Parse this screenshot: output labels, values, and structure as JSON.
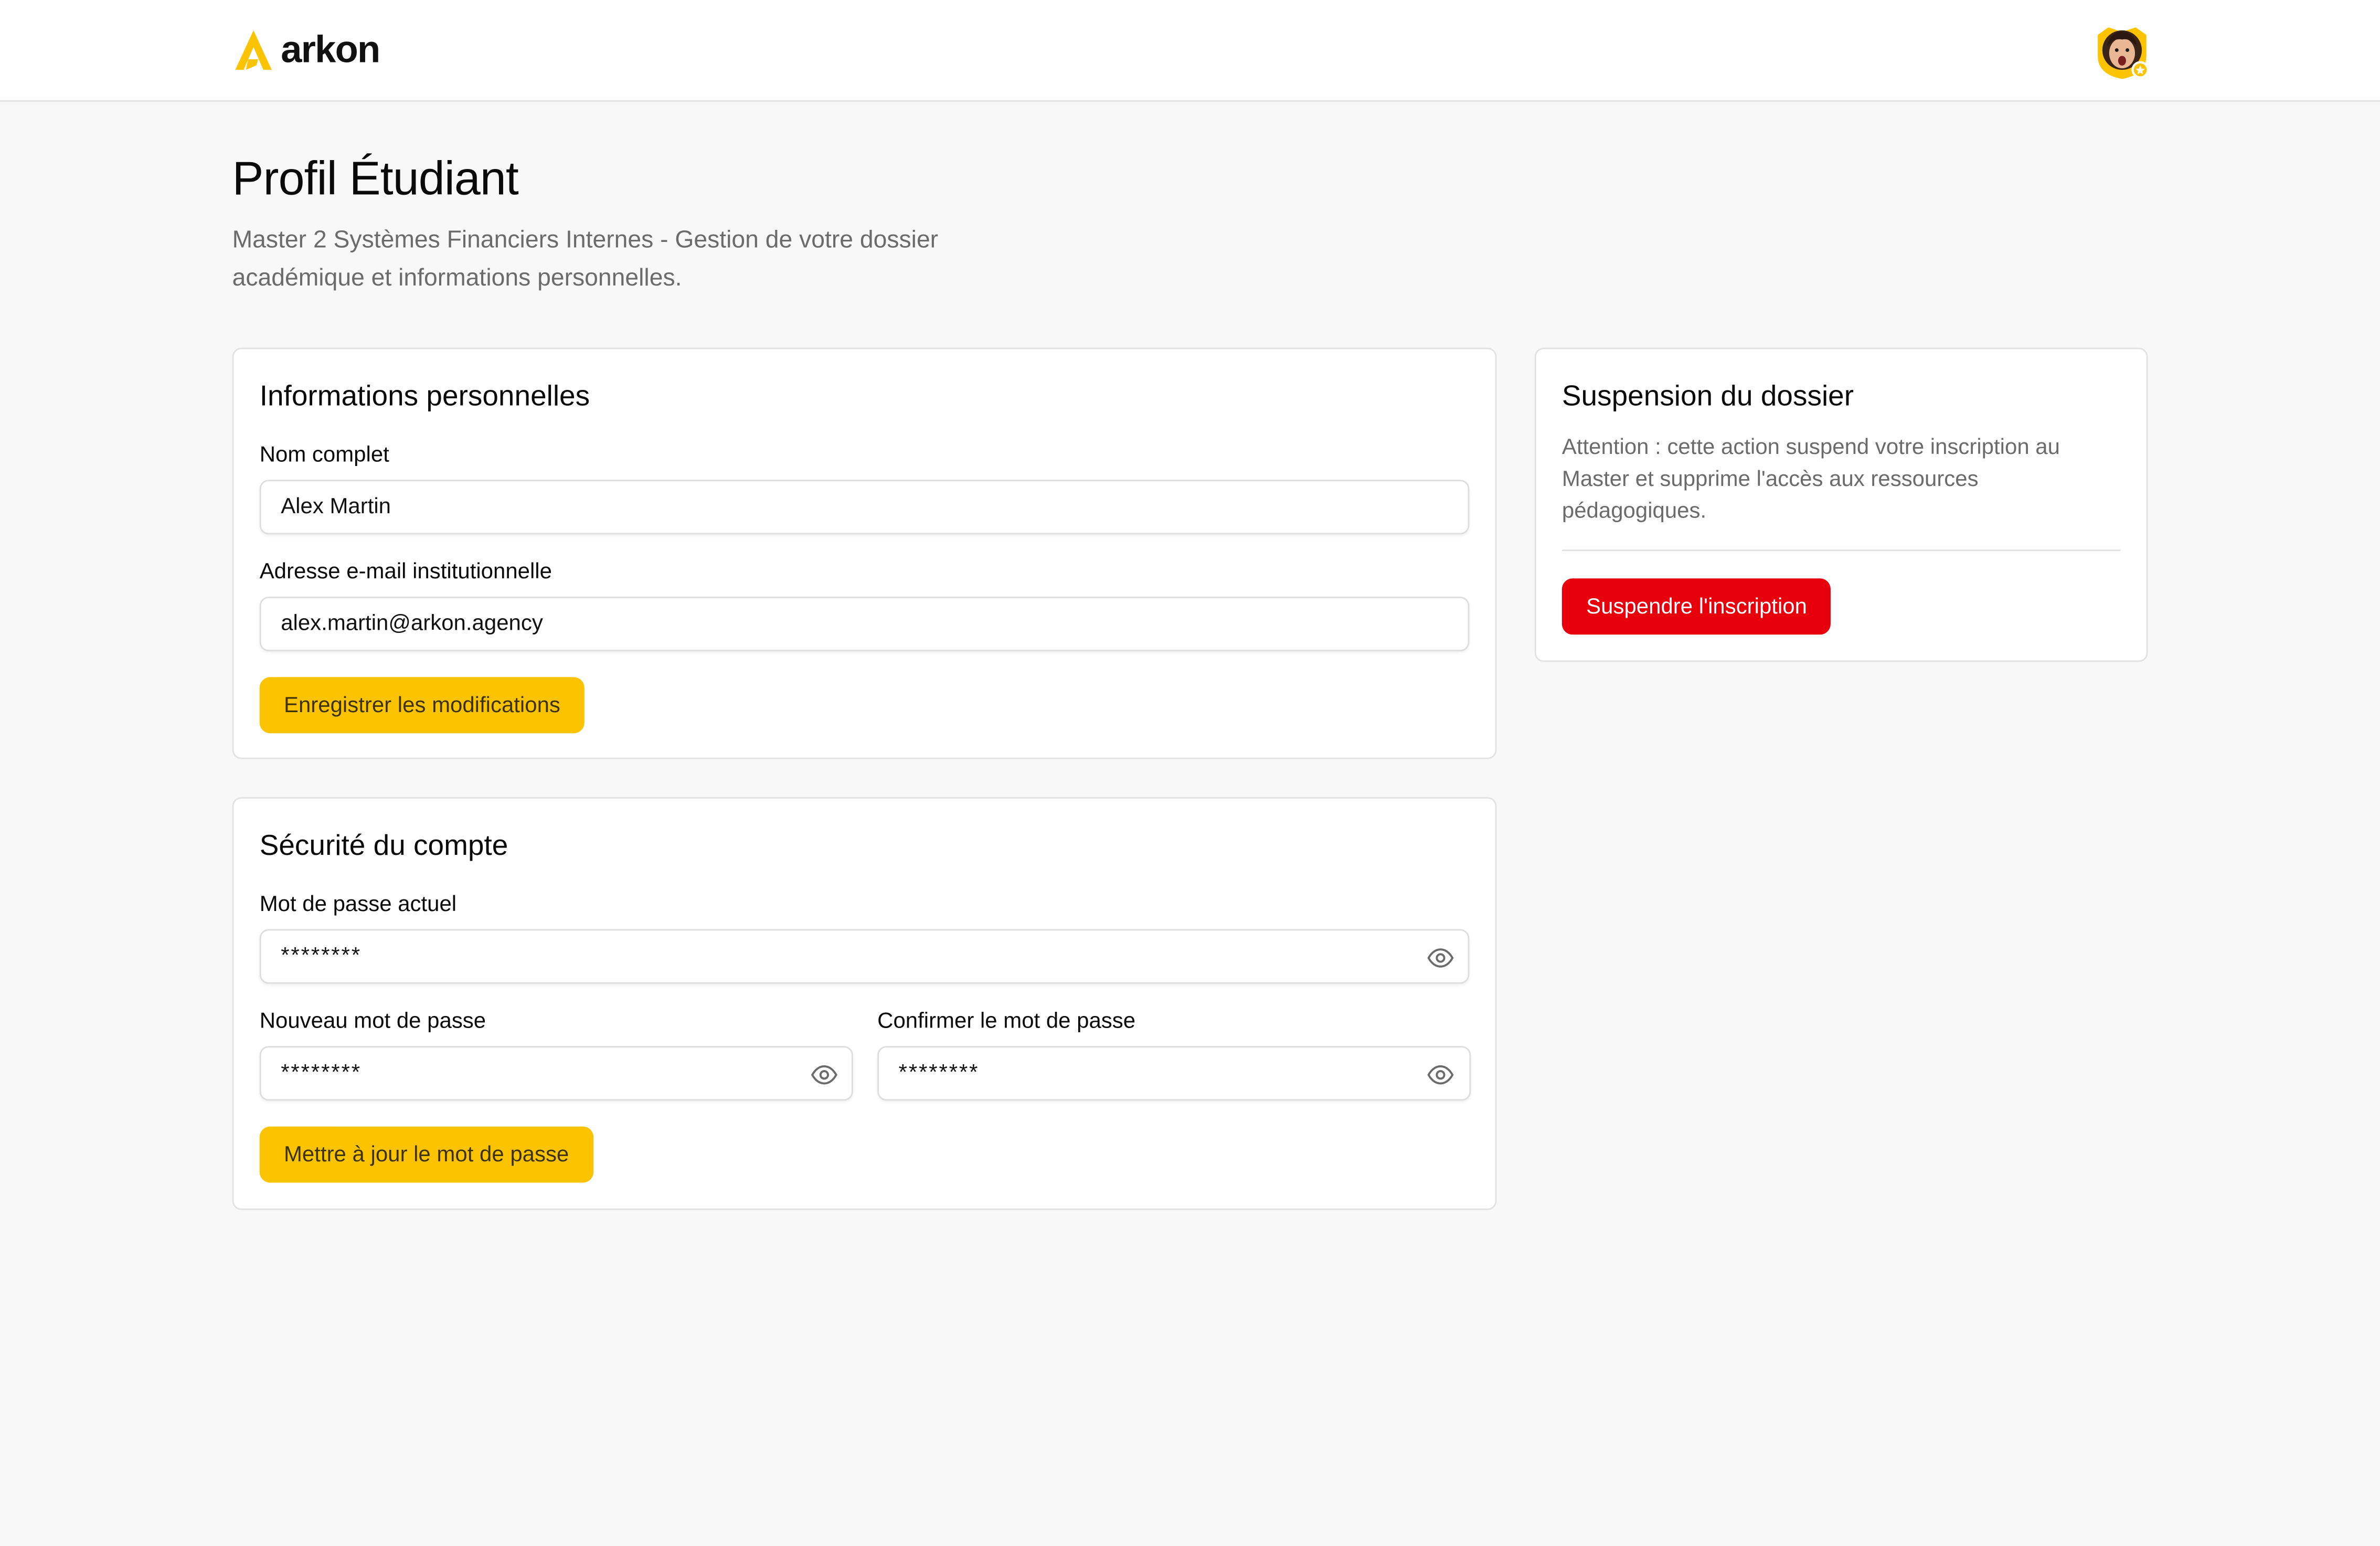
{
  "brand": {
    "name": "arkon",
    "accent_color": "#fcc400",
    "logo_icon": "arkon-logo-icon"
  },
  "header": {
    "avatar_icon": "user-avatar"
  },
  "page": {
    "title": "Profil Étudiant",
    "subtitle": "Master 2 Systèmes Financiers Internes - Gestion de votre dossier académique et informations personnelles."
  },
  "personal_info": {
    "title": "Informations personnelles",
    "name_label": "Nom complet",
    "name_value": "Alex Martin",
    "email_label": "Adresse e-mail institutionnelle",
    "email_value": "alex.martin@arkon.agency",
    "save_label": "Enregistrer les modifications"
  },
  "security": {
    "title": "Sécurité du compte",
    "current_label": "Mot de passe actuel",
    "current_value": "********",
    "new_label": "Nouveau mot de passe",
    "new_value": "********",
    "confirm_label": "Confirmer le mot de passe",
    "confirm_value": "********",
    "update_label": "Mettre à jour le mot de passe",
    "visibility_icon": "eye-icon"
  },
  "suspension": {
    "title": "Suspension du dossier",
    "warning": "Attention : cette action suspend votre inscription au Master et supprime l'accès aux ressources pédagogiques.",
    "button_label": "Suspendre l'inscription",
    "danger_color": "#e7000b"
  }
}
